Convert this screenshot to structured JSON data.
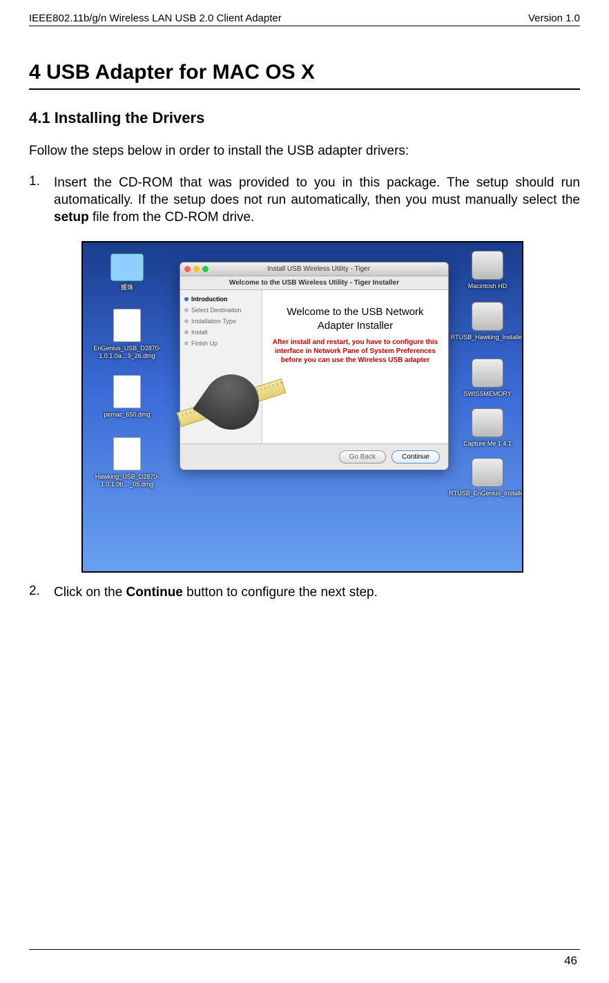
{
  "header": {
    "left": "IEEE802.11b/g/n Wireless LAN USB 2.0 Client Adapter",
    "right": "Version 1.0"
  },
  "chapter": "4  USB Adapter for MAC OS X",
  "section": "4.1  Installing the Drivers",
  "intro": "Follow the steps below in order to install the USB adapter drivers:",
  "steps": {
    "s1": {
      "num": "1.",
      "pre": "Insert the CD-ROM that was provided to you in this package. The setup should run automatically. If the setup does not run automatically, then you must manually select the ",
      "bold": "setup",
      "post": " file from the CD-ROM drive."
    },
    "s2": {
      "num": "2.",
      "pre": "Click on the ",
      "bold": "Continue",
      "post": " button to configure the next step."
    }
  },
  "shot": {
    "left_icons": {
      "folder": "媛珠",
      "dmg1": "EnGenius_USB_D2870-1.0.1.0a…9_26.dmg",
      "dmg2": "pemac_650.dmg",
      "dmg3": "Hawking_USB_D2870-1.0.1.0b…_05.dmg"
    },
    "right_icons": {
      "d1": "Macintosh HD",
      "d2": "RTUSB_Hawking_Installer",
      "d3": "SWISSMEMORY",
      "d4": "Capture Me 1.4.1",
      "d5": "RTUSB_EnGenius_Installer"
    },
    "installer": {
      "title": "Install USB Wireless Utility - Tiger",
      "subtitle": "Welcome to the USB Wireless Utility - Tiger Installer",
      "side": {
        "a": "Introduction",
        "b": "Select Destination",
        "c": "Installation Type",
        "d": "Install",
        "e": "Finish Up"
      },
      "main_big": "Welcome to the USB Network Adapter Installer",
      "main_red": "After install and restart, you have to configure this interface in Network Pane of System Preferences before you can use the Wireless USB adapter",
      "btn_back": "Go Back",
      "btn_cont": "Continue"
    }
  },
  "page_number": "46"
}
